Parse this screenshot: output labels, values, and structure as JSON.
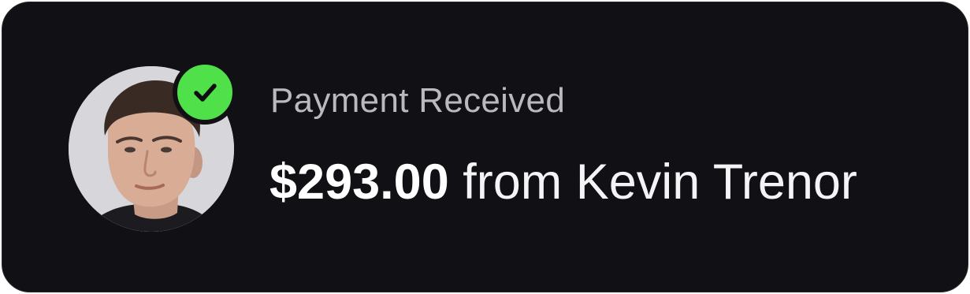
{
  "notification": {
    "title": "Payment Received",
    "amount": "$293.00",
    "message_suffix": " from Kevin Trenor",
    "status": "success"
  },
  "icons": {
    "avatar": "user-avatar-photo",
    "badge": "checkmark-icon"
  },
  "colors": {
    "card_background": "#111015",
    "badge_green": "#4fe04a",
    "title_gray": "#b9b9be",
    "text_white": "#f4f4f6"
  }
}
